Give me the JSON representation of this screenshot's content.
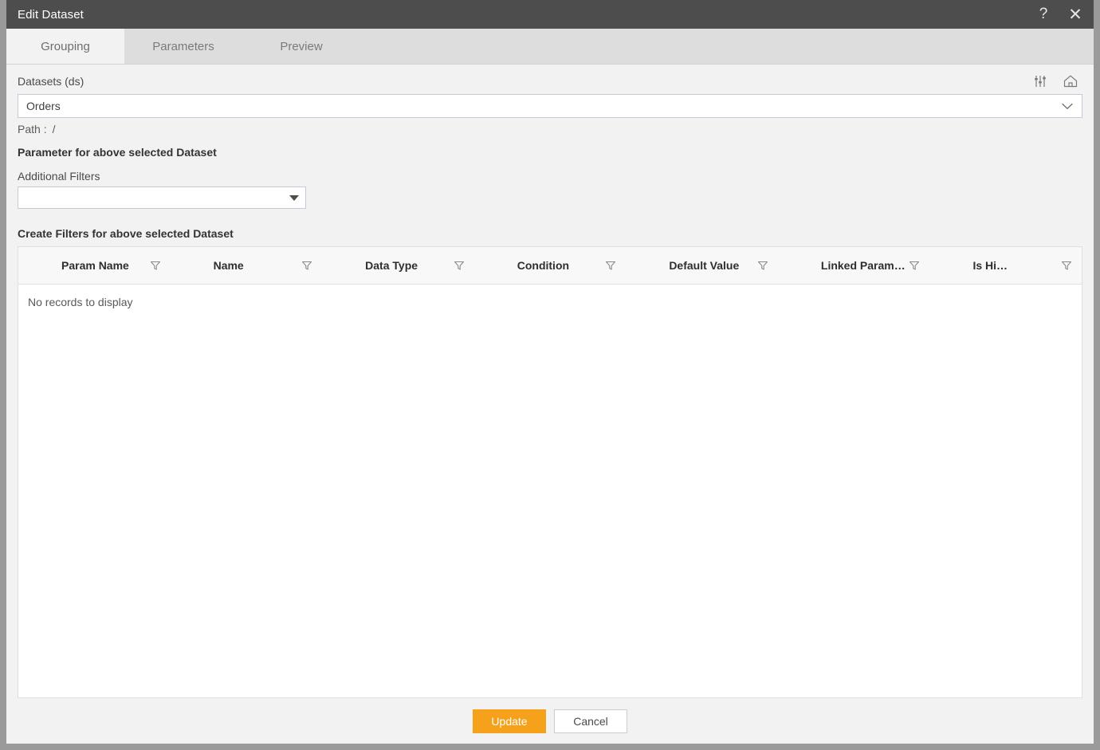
{
  "window": {
    "title": "Edit Dataset",
    "help_icon": "question-mark-icon",
    "close_icon": "close-icon"
  },
  "tabs": [
    {
      "label": "Grouping",
      "active": true
    },
    {
      "label": "Parameters",
      "active": false
    },
    {
      "label": "Preview",
      "active": false
    }
  ],
  "dataset": {
    "label": "Datasets (ds)",
    "selected": "Orders",
    "settings_icon": "sliders-icon",
    "home_icon": "home-icon",
    "chevron_icon": "chevron-down-icon",
    "path_label": "Path :",
    "path_value": "/"
  },
  "parameter_section": {
    "title": "Parameter for above selected Dataset",
    "additional_filters_label": "Additional Filters",
    "additional_filters_value": "",
    "caret_icon": "triangle-down-icon"
  },
  "filters_section": {
    "title": "Create Filters for above selected Dataset",
    "columns": [
      "Param Name",
      "Name",
      "Data Type",
      "Condition",
      "Default Value",
      "Linked Param…",
      "Is Hi…"
    ],
    "filter_icon": "funnel-icon",
    "empty_message": "No records to display",
    "rows": []
  },
  "footer": {
    "update_label": "Update",
    "cancel_label": "Cancel"
  },
  "colors": {
    "titlebar": "#4d4d4d",
    "tabstrip": "#dddddd",
    "body": "#f2f2f2",
    "accent": "#f5a11b",
    "grid_header": "#f8f8f8"
  }
}
